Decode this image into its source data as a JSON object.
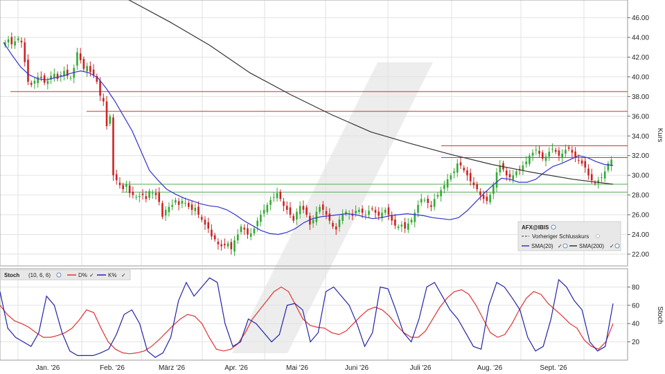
{
  "chart_data": [
    {
      "type": "candlestick",
      "legend": {
        "symbol": "AFX@IBIS",
        "prev_close_label": "Vorheriger Schlusskurs",
        "sma20_label": "SMA(20)",
        "sma200_label": "SMA(200)"
      },
      "y_axis_label": "Kurs",
      "ylim": [
        20.8,
        47.8
      ],
      "y_ticks": [
        "22.00",
        "24.00",
        "26.00",
        "28.00",
        "30.00",
        "32.00",
        "34.00",
        "36.00",
        "38.00",
        "40.00",
        "42.00",
        "44.00",
        "46.00"
      ],
      "x_tick_labels": [
        "Jan. '26",
        "Feb. '26",
        "März '26",
        "Apr. '26",
        "Mai '26",
        "Juni '26",
        "Juli '26",
        "Aug. '26",
        "Sept. '26"
      ],
      "grid": true,
      "colors": {
        "up": "#33aa33",
        "down": "#cc2222",
        "sma20": "#3333cc",
        "sma200": "#333333",
        "resistance": "#cc3333",
        "support": "#55aa55"
      },
      "horizontal_levels": {
        "resistance": [
          38.5,
          36.5,
          33.0,
          31.8
        ],
        "support": [
          29.1,
          28.3
        ]
      },
      "close": [
        43.5,
        43.8,
        43.3,
        43.6,
        43.9,
        43.5,
        41.5,
        39.5,
        39.2,
        39.6,
        40.0,
        39.9,
        39.4,
        39.6,
        40.1,
        40.3,
        39.8,
        40.2,
        40.6,
        40.1,
        39.9,
        40.9,
        42.5,
        41.7,
        40.8,
        41.1,
        40.5,
        40.2,
        39.5,
        38.1,
        37.5,
        35.0,
        36.0,
        30.0,
        29.5,
        29.0,
        28.6,
        29.1,
        28.2,
        28.0,
        27.8,
        27.9,
        28.0,
        27.6,
        28.4,
        28.2,
        28.0,
        27.3,
        25.8,
        26.5,
        26.8,
        27.0,
        27.5,
        27.0,
        27.4,
        27.2,
        26.8,
        26.5,
        26.7,
        26.0,
        25.5,
        25.0,
        24.6,
        23.8,
        23.5,
        23.0,
        22.8,
        22.9,
        23.1,
        22.5,
        23.4,
        24.0,
        24.8,
        24.5,
        24.0,
        24.1,
        24.6,
        25.4,
        26.0,
        26.5,
        27.0,
        27.5,
        27.8,
        28.2,
        27.6,
        26.9,
        26.5,
        26.0,
        25.4,
        26.3,
        26.9,
        26.5,
        26.0,
        25.0,
        25.5,
        26.3,
        26.8,
        26.5,
        26.0,
        25.4,
        24.8,
        24.5,
        25.5,
        26.0,
        26.3,
        26.1,
        25.9,
        26.4,
        26.5,
        26.2,
        26.0,
        26.4,
        26.6,
        26.2,
        25.9,
        26.2,
        26.5,
        26.0,
        25.4,
        24.9,
        24.8,
        25.0,
        24.6,
        25.1,
        25.5,
        26.2,
        27.0,
        27.6,
        27.5,
        27.2,
        26.8,
        27.6,
        28.0,
        28.5,
        29.0,
        29.6,
        30.0,
        30.4,
        31.2,
        31.0,
        30.5,
        30.0,
        29.4,
        29.0,
        28.6,
        28.0,
        27.6,
        27.4,
        28.0,
        29.0,
        30.3,
        31.0,
        30.6,
        30.0,
        29.8,
        30.0,
        30.4,
        30.6,
        31.0,
        31.4,
        32.0,
        32.3,
        32.6,
        32.2,
        31.7,
        31.9,
        32.4,
        32.7,
        32.4,
        32.0,
        32.2,
        32.6,
        32.7,
        32.3,
        31.8,
        31.5,
        31.2,
        30.8,
        30.0,
        29.5,
        29.2,
        29.5,
        29.8,
        30.4,
        31.2,
        31.6
      ],
      "sma20_approx": [
        43.5,
        42.2,
        41.0,
        40.2,
        39.8,
        39.7,
        39.9,
        40.1,
        40.4,
        40.6,
        40.4,
        39.9,
        38.8,
        37.5,
        36.0,
        34.5,
        32.5,
        30.5,
        29.5,
        28.6,
        28.1,
        27.7,
        27.4,
        27.1,
        26.9,
        26.8,
        26.5,
        26.0,
        25.4,
        24.9,
        24.4,
        24.1,
        24.0,
        24.2,
        24.6,
        25.2,
        25.6,
        25.8,
        25.9,
        26.0,
        26.1,
        26.0,
        25.8,
        25.6,
        25.7,
        25.9,
        26.0,
        26.1,
        26.0,
        25.9,
        25.7,
        25.6,
        25.5,
        25.7,
        26.4,
        27.3,
        28.2,
        29.0,
        29.7,
        29.6,
        29.3,
        29.3,
        29.6,
        30.3,
        30.9,
        31.2,
        31.6,
        32.0,
        31.8,
        31.4,
        31.1,
        31.0
      ],
      "sma200_approx": [
        50.0,
        47.8,
        45.6,
        43.2,
        40.4,
        38.2,
        36.2,
        34.4,
        33.2,
        32.1,
        31.1,
        30.3,
        29.6,
        29.1
      ]
    },
    {
      "type": "line",
      "indicator": "Stoch",
      "params": "(10, 6, 6)",
      "y_axis_label": "Stoch",
      "ylim": [
        0,
        100
      ],
      "y_ticks": [
        "20",
        "40",
        "60",
        "80"
      ],
      "series": [
        {
          "name": "D%",
          "color": "#dd3333",
          "values": [
            60,
            50,
            43,
            40,
            36,
            30,
            25,
            25,
            27,
            30,
            35,
            44,
            55,
            52,
            35,
            20,
            12,
            8,
            7,
            8,
            10,
            15,
            22,
            30,
            38,
            45,
            50,
            48,
            40,
            25,
            12,
            10,
            12,
            18,
            30,
            45,
            55,
            65,
            75,
            80,
            75,
            60,
            45,
            38,
            36,
            35,
            30,
            28,
            32,
            40,
            48,
            55,
            58,
            55,
            48,
            38,
            30,
            25,
            25,
            32,
            45,
            58,
            68,
            75,
            77,
            72,
            60,
            45,
            30,
            25,
            28,
            40,
            55,
            68,
            75,
            72,
            62,
            55,
            48,
            40,
            35,
            22,
            15,
            12,
            20,
            40
          ]
        },
        {
          "name": "K%",
          "color": "#2222aa",
          "values": [
            75,
            35,
            25,
            20,
            15,
            30,
            70,
            60,
            30,
            10,
            5,
            5,
            5,
            8,
            12,
            28,
            50,
            55,
            40,
            10,
            3,
            8,
            25,
            65,
            85,
            70,
            80,
            90,
            85,
            40,
            15,
            20,
            45,
            40,
            30,
            20,
            28,
            60,
            62,
            55,
            20,
            30,
            75,
            80,
            70,
            60,
            40,
            15,
            30,
            80,
            78,
            55,
            30,
            20,
            45,
            80,
            85,
            70,
            55,
            45,
            30,
            15,
            12,
            60,
            85,
            80,
            68,
            55,
            25,
            10,
            15,
            45,
            88,
            80,
            65,
            55,
            20,
            10,
            15,
            62
          ]
        }
      ]
    }
  ]
}
